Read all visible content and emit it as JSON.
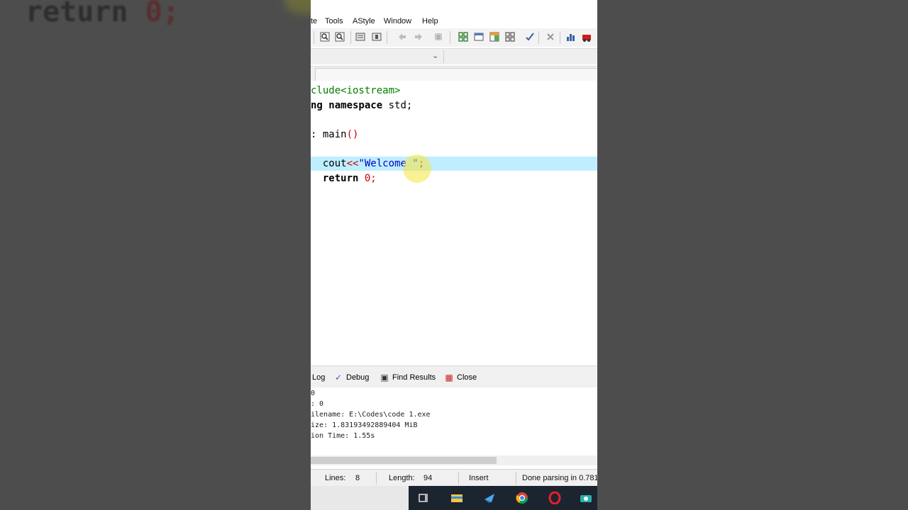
{
  "background_code": {
    "keyword": "return",
    "number": "0",
    "semicolon": ";"
  },
  "menu": [
    "te",
    "Tools",
    "AStyle",
    "Window",
    "Help"
  ],
  "toolbar_icons": [
    "find-icon",
    "replace-icon",
    "goto-icon",
    "bookmark-icon",
    "back-icon",
    "forward-icon",
    "clean-icon",
    "grid-icon",
    "window-icon",
    "layout-icon",
    "tiles-icon",
    "check-icon",
    "delete-icon",
    "chart-icon",
    "profile-icon"
  ],
  "code": {
    "line1": {
      "text": "clude<iostream>"
    },
    "line2": {
      "kw": "ng namespace",
      "rest": " std;"
    },
    "line3": {
      "prefix": ":",
      "fn": " main",
      "paren": "()"
    },
    "line4": {
      "indent": "  ",
      "fn": "cout",
      "op": "<<",
      "str": "\"Welcome \"",
      "semi": ";"
    },
    "line5": {
      "indent": "  ",
      "kw": "return",
      "num": " 0",
      "semi": ";"
    }
  },
  "message_tabs": [
    "Log",
    "Debug",
    "Find Results",
    "Close"
  ],
  "log_lines": [
    "0",
    ": 0",
    "ilename: E:\\Codes\\code 1.exe",
    "ize: 1.83193492889404 MiB",
    "ion Time: 1.55s"
  ],
  "status": {
    "lines_label": "Lines:",
    "lines_value": "8",
    "length_label": "Length:",
    "length_value": "94",
    "mode": "Insert",
    "parse": "Done parsing in 0.781"
  },
  "taskbar_icons": [
    "task-view-icon",
    "file-explorer-icon",
    "app-icon",
    "chrome-icon",
    "opera-icon",
    "camera-icon"
  ],
  "colors": {
    "highlight": "#bfeeff",
    "preprocessor": "#008000",
    "string": "#0000cc",
    "number": "#cc0000"
  }
}
